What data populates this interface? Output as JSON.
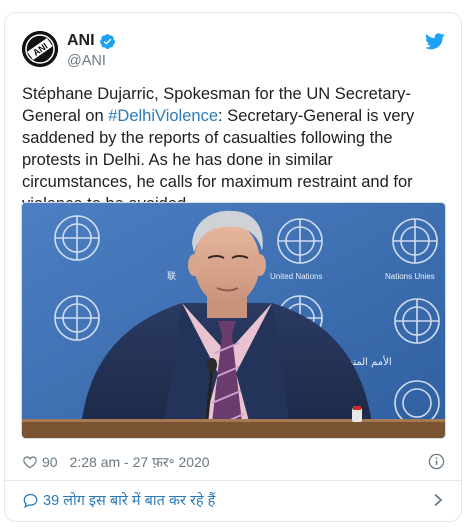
{
  "tweet": {
    "display_name": "ANI",
    "handle": "@ANI",
    "avatar_text": "ANI",
    "text_before": "Stéphane Dujarric, Spokesman for the UN Secretary-General on ",
    "hashtag": "#DelhiViolence",
    "text_after": ": Secretary-General is very saddened by the reports of casualties following the protests in Delhi. As he has done in similar circumstances, he calls for maximum restraint and for violence to be avoided.",
    "media": {
      "backdrop_text_left": "United Nations",
      "backdrop_text_right": "Nations Unies",
      "backdrop_text_arabic": "الأمم المتحدة",
      "backdrop_text_chinese": "联"
    },
    "likes": "90",
    "timestamp": "2:28 am - 27 फ़र॰ 2020",
    "footer_text": "39 लोग इस बारे में बात कर रहे हैं"
  },
  "colors": {
    "link": "#2b7bb9",
    "meta": "#697882",
    "verified": "#1da1f2",
    "un_blue": "#3f6fb4"
  },
  "icons": [
    "twitter-bird-icon",
    "verified-badge-icon",
    "heart-icon",
    "info-icon",
    "speech-bubble-icon",
    "chevron-right-icon"
  ]
}
